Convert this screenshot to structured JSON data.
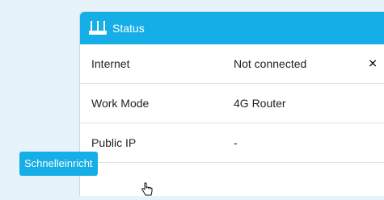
{
  "header": {
    "title": "Status",
    "icon": "router-icon"
  },
  "rows": [
    {
      "label": "Internet",
      "value": "Not connected",
      "action_icon": "close-icon",
      "action_symbol": "✕"
    },
    {
      "label": "Work Mode",
      "value": "4G Router"
    },
    {
      "label": "Public IP",
      "value": "-"
    }
  ],
  "button": {
    "label": "Schnelleinricht"
  },
  "colors": {
    "accent": "#15aee6",
    "page_bg": "#e6f3fa"
  }
}
